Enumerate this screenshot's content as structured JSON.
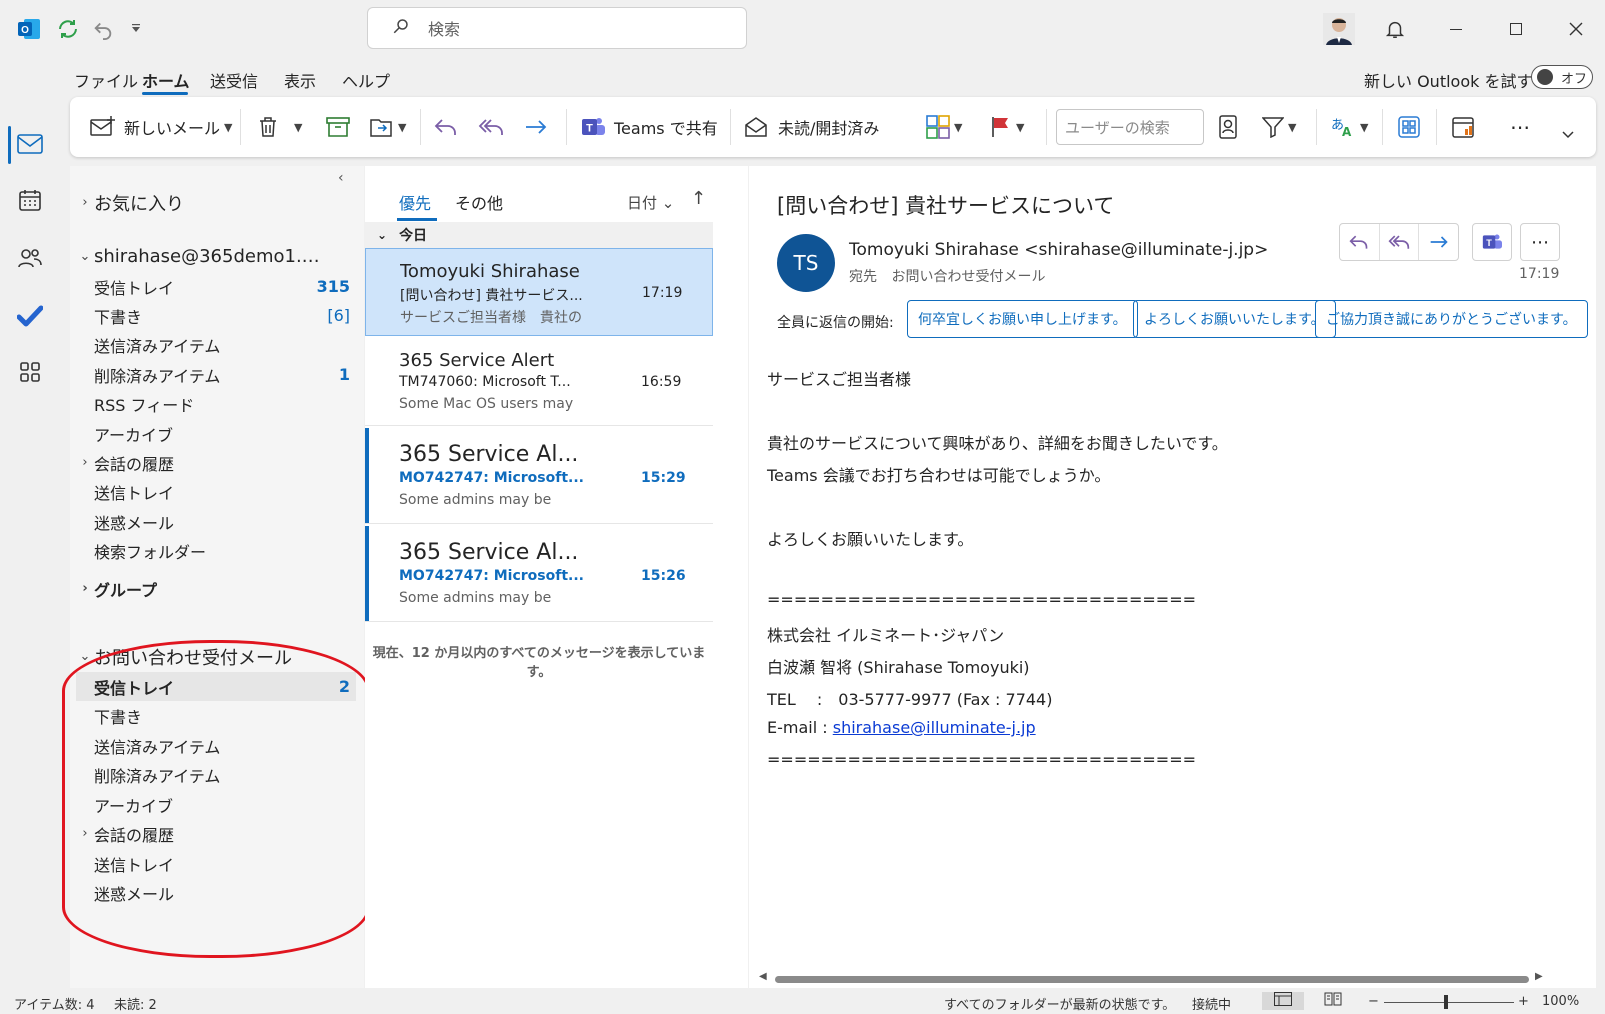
{
  "titlebar": {
    "search_placeholder": "検索"
  },
  "menu": {
    "items": [
      "ファイル",
      "ホーム",
      "送受信",
      "表示",
      "ヘルプ"
    ],
    "try_new_outlook": "新しい Outlook を試す",
    "toggle_label": "オフ"
  },
  "ribbon": {
    "new_mail": "新しいメール",
    "teams_share": "Teams で共有",
    "read_unread": "未読/開封済み",
    "user_search_placeholder": "ユーザーの検索"
  },
  "folders": {
    "favorites": "お気に入り",
    "account": "shirahase@365demo1.…",
    "account_items": [
      {
        "name": "受信トレイ",
        "count": "315"
      },
      {
        "name": "下書き",
        "count": "[6]"
      },
      {
        "name": "送信済みアイテム",
        "count": ""
      },
      {
        "name": "削除済みアイテム",
        "count": "1"
      },
      {
        "name": "RSS フィード",
        "count": ""
      },
      {
        "name": "アーカイブ",
        "count": ""
      },
      {
        "name": "会話の履歴",
        "count": ""
      },
      {
        "name": "送信トレイ",
        "count": ""
      },
      {
        "name": "迷惑メール",
        "count": ""
      },
      {
        "name": "検索フォルダー",
        "count": ""
      }
    ],
    "groups": "グループ",
    "shared_mailbox": "お問い合わせ受付メール",
    "shared_items": [
      {
        "name": "受信トレイ",
        "count": "2"
      },
      {
        "name": "下書き",
        "count": ""
      },
      {
        "name": "送信済みアイテム",
        "count": ""
      },
      {
        "name": "削除済みアイテム",
        "count": ""
      },
      {
        "name": "アーカイブ",
        "count": ""
      },
      {
        "name": "会話の履歴",
        "count": ""
      },
      {
        "name": "送信トレイ",
        "count": ""
      },
      {
        "name": "迷惑メール",
        "count": ""
      }
    ]
  },
  "list": {
    "tab_focused": "優先",
    "tab_other": "その他",
    "sort_label": "日付",
    "group_today": "今日",
    "messages": [
      {
        "from": "Tomoyuki Shirahase",
        "subject": "[問い合わせ] 貴社サービス...",
        "preview": "サービスご担当者様　貴社の",
        "time": "17:19"
      },
      {
        "from": "365 Service Alert",
        "subject": "TM747060: Microsoft T...",
        "preview": "Some Mac OS users may",
        "time": "16:59"
      },
      {
        "from": "365 Service Al...",
        "subject": "MO742747: Microsoft...",
        "preview": "Some admins may be",
        "time": "15:29"
      },
      {
        "from": "365 Service Al...",
        "subject": "MO742747: Microsoft...",
        "preview": "Some admins may be",
        "time": "15:26"
      }
    ],
    "footer_note": "現在、12 か月以内のすべてのメッセージを表示しています。"
  },
  "reading": {
    "subject": "[問い合わせ] 貴社サービスについて",
    "avatar_initials": "TS",
    "from": "Tomoyuki Shirahase <shirahase@illuminate-j.jp>",
    "to_label": "宛先",
    "to": "お問い合わせ受付メール",
    "time": "17:19",
    "quick_reply_label": "全員に返信の開始:",
    "quick_replies": [
      "何卒宜しくお願い申し上げます。",
      "よろしくお願いいたします。",
      "ご協力頂き誠にありがとうございます。"
    ],
    "body": {
      "greeting": "サービスご担当者様",
      "line1": "貴社のサービスについて興味があり、詳細をお聞きしたいです。",
      "line2": "Teams 会議でお打ち合わせは可能でしょうか。",
      "closing": "よろしくお願いいたします。",
      "separator": "================================",
      "company": "株式会社 イルミネート･ジャパン",
      "name": "白波瀬 智将 (Shirahase Tomoyuki)",
      "tel": "TEL　 :　03-5777-9977 (Fax : 7744)",
      "email_label": "E-mail  : ",
      "email": "shirahase@illuminate-j.jp",
      "separator2": "================================"
    }
  },
  "statusbar": {
    "items": "アイテム数: 4",
    "unread": "未読: 2",
    "sync": "すべてのフォルダーが最新の状態です。",
    "connection": "接続中",
    "zoom": "100%"
  },
  "colors": {
    "accent": "#0f6cbd",
    "avatar": "#0f5495",
    "highlight_circle": "#e0151f",
    "selected_message": "#cfe4fa"
  }
}
